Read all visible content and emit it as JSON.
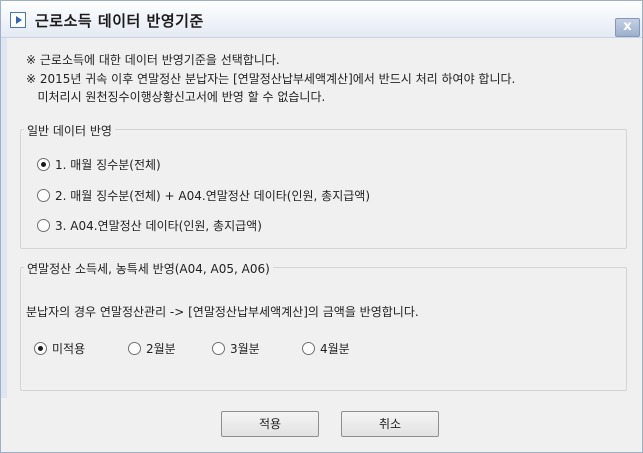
{
  "window": {
    "title": "근로소득 데이터 반영기준",
    "close_label": "x"
  },
  "notes": [
    "※ 근로소득에 대한 데이터 반영기준을 선택합니다.",
    "※ 2015년 귀속 이후 연말정산 분납자는 [연말정산납부세액계산]에서 반드시 처리 하여야 합니다.",
    "   미처리시 원천징수이행상황신고서에 반영 할 수 없습니다."
  ],
  "general_group": {
    "legend": "일반 데이터 반영",
    "selected_index": 0,
    "options": [
      "1. 매월 징수분(전체)",
      "2. 매월 징수분(전체) + A04.연말정산 데이타(인원, 총지급액)",
      "3. A04.연말정산 데이타(인원, 총지급액)"
    ]
  },
  "tax_group": {
    "legend": "연말정산 소득세, 농특세 반영(A04, A05, A06)",
    "description": "분납자의 경우 연말정산관리 -> [연말정산납부세액계산]의 금액을 반영합니다.",
    "selected_index": 0,
    "options": [
      "미적용",
      "2월분",
      "3월분",
      "4월분"
    ]
  },
  "buttons": {
    "ok": "적용",
    "cancel": "취소"
  }
}
